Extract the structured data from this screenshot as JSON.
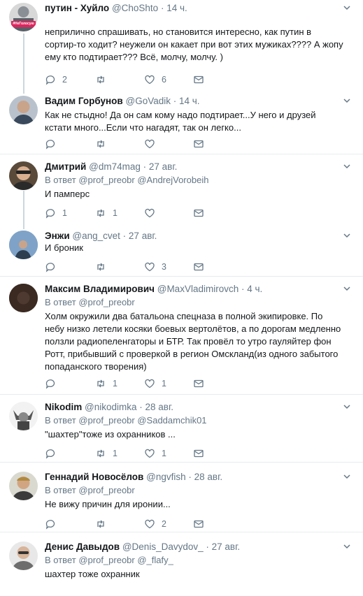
{
  "tweets": [
    {
      "name": "путин - Хуйло",
      "handle": "@ChoShto",
      "time": "14 ч.",
      "reply_prefix": "",
      "reply_to": "",
      "text": "неприлично спрашивать, но становится интересно, как путин в сортир-то ходит? неужели он какает при вот этих мужиках???? А жопу ему кто подтирает??? Всё, молчу, молчу. )",
      "replies": "2",
      "retweets": "",
      "likes": "6",
      "avatar_badge": "#НеГолосую"
    },
    {
      "name": "Вадим Горбунов",
      "handle": "@GoVadik",
      "time": "14 ч.",
      "reply_prefix": "",
      "reply_to": "",
      "text": "Как не стыдно! Да он сам кому надо подтирает...У него и друзей кстати много...Если что нагадят, так он легко...",
      "replies": "",
      "retweets": "",
      "likes": ""
    },
    {
      "name": "Дмитрий",
      "handle": "@dm74mag",
      "time": "27 авг.",
      "reply_prefix": "В ответ",
      "reply_to": "@prof_preobr @AndrejVorobeih",
      "text": "И памперс",
      "replies": "1",
      "retweets": "1",
      "likes": ""
    },
    {
      "name": "Энжи",
      "handle": "@ang_cvet",
      "time": "27 авг.",
      "reply_prefix": "",
      "reply_to": "",
      "text": "И броник",
      "replies": "",
      "retweets": "",
      "likes": "3"
    },
    {
      "name": "Максим Владимирович",
      "handle": "@MaxVladimirovch",
      "time": "4 ч.",
      "reply_prefix": "В ответ",
      "reply_to": "@prof_preobr",
      "text": "Холм окружили два батальона спецназа в полной экипировке. По небу низко летели косяки боевых вертолётов, а по дорогам медленно ползли радиопеленгаторы и БТР. Так провёл то утро гауляйтер фон Ротт, прибывший с проверкой в регион Омскланд(из одного забытого попаданского творения)",
      "replies": "",
      "retweets": "1",
      "likes": "1"
    },
    {
      "name": "Nikodim",
      "handle": "@nikodimka",
      "time": "28 авг.",
      "reply_prefix": "В ответ",
      "reply_to": "@prof_preobr @Saddamchik01",
      "text": "\"шахтер\"тоже из охранников ...",
      "replies": "",
      "retweets": "1",
      "likes": "1"
    },
    {
      "name": "Геннадий Новосёлов",
      "handle": "@ngvfish",
      "time": "28 авг.",
      "reply_prefix": "В ответ",
      "reply_to": "@prof_preobr",
      "text": "Не вижу причин для иронии...",
      "replies": "",
      "retweets": "",
      "likes": "2"
    },
    {
      "name": "Денис Давыдов",
      "handle": "@Denis_Davydov_",
      "time": "27 авг.",
      "reply_prefix": "В ответ",
      "reply_to": "@prof_preobr @_flafy_",
      "text": "шахтер тоже охранник",
      "replies": "",
      "retweets": "",
      "likes": ""
    }
  ]
}
